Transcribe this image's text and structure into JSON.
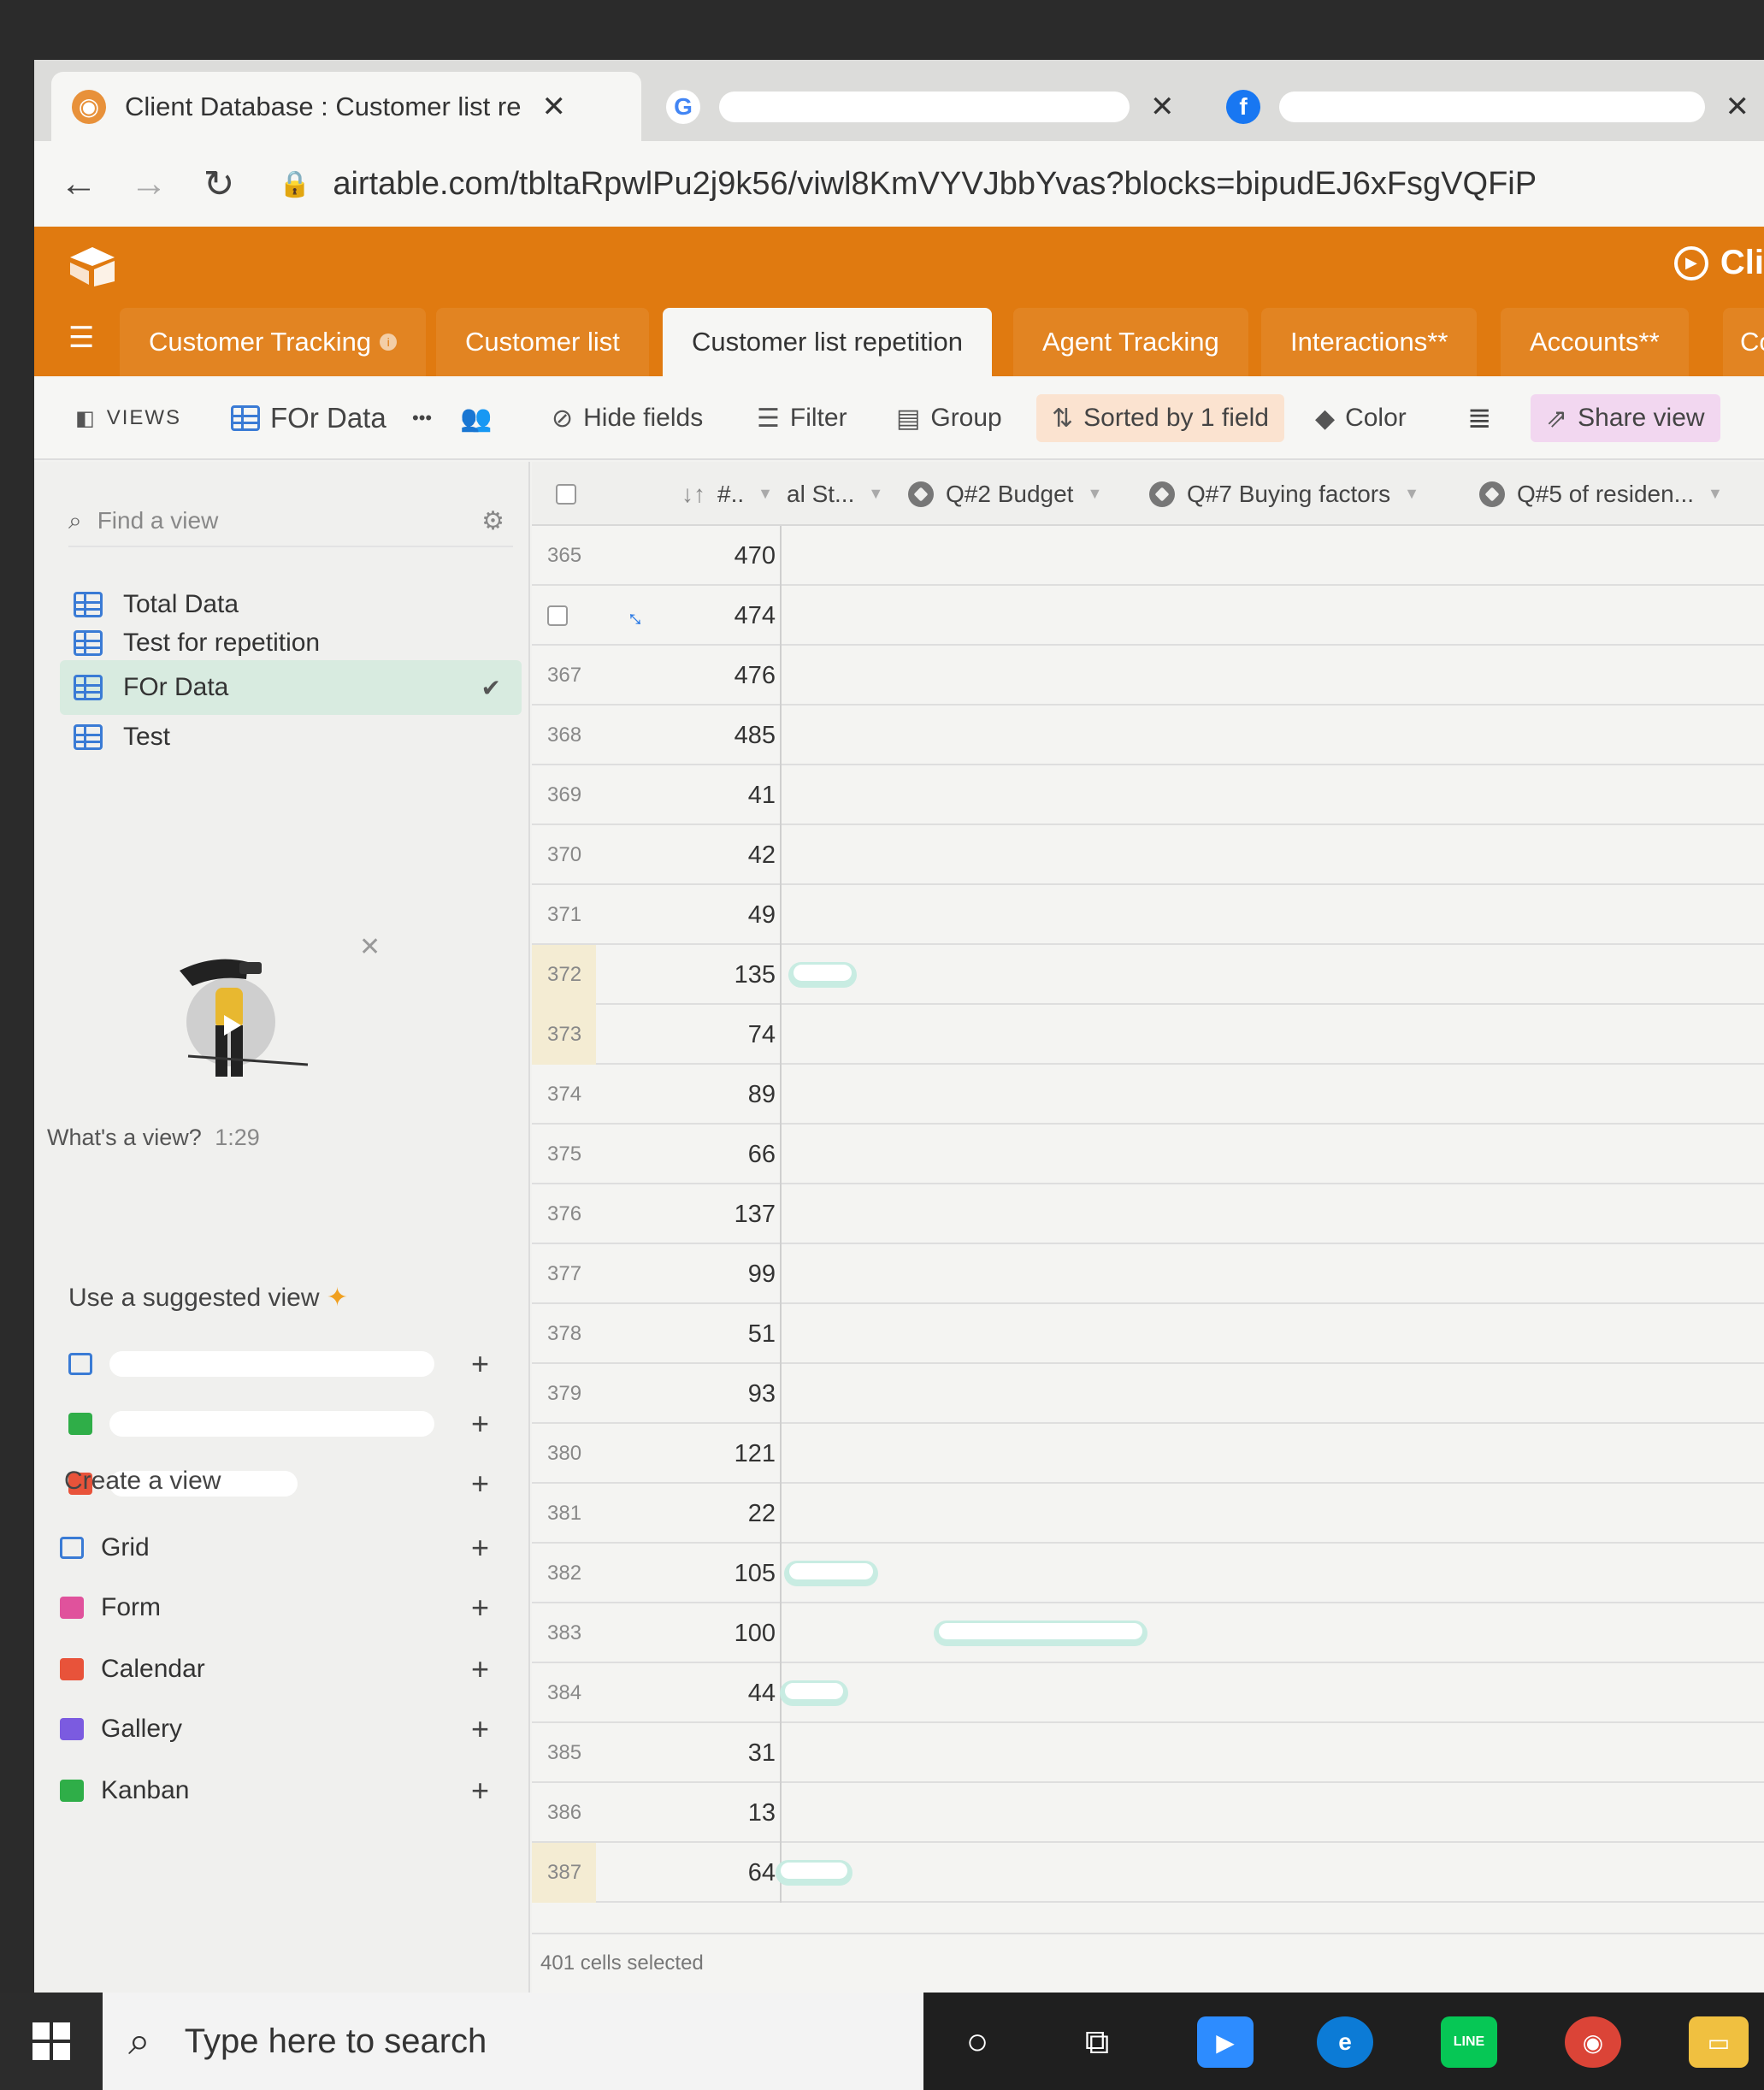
{
  "browser": {
    "tabs": [
      {
        "title": "Client Database : Customer list re",
        "favicon": "airtable-icon",
        "active": true
      },
      {
        "title": "",
        "favicon": "google-icon",
        "active": false
      },
      {
        "title": "",
        "favicon": "facebook-icon",
        "active": false
      }
    ],
    "close_glyph": "✕",
    "url": "airtable.com/tblta​RpwlPu2j9k56/viwl8KmVYVJbbYvas?blocks=bipudEJ6xFsgVQFiP"
  },
  "app": {
    "base_name": "Cli",
    "table_tabs": [
      "Customer Tracking",
      "Customer list",
      "Customer list repetition",
      "Agent Tracking",
      "Interactions**",
      "Accounts**",
      "Co"
    ],
    "active_table": "Customer list repetition",
    "accent_color": "#e07a10"
  },
  "viewbar": {
    "views_label": "VIEWS",
    "current_view": "FOr Data",
    "more": "•••",
    "hide_fields": "Hide fields",
    "filter": "Filter",
    "group": "Group",
    "sorted": "Sorted by 1 field",
    "color": "Color",
    "share": "Share view"
  },
  "sidebar": {
    "find_placeholder": "Find a view",
    "views": [
      "Total Data",
      "Test for repetition",
      "FOr Data",
      "Test"
    ],
    "selected_view": "FOr Data",
    "check": "✔",
    "close": "✕",
    "whats_a_view": "What's a view?",
    "video_time": "1:29",
    "suggested_title": "Use a suggested view",
    "create_title": "Create a view",
    "create_options": [
      {
        "label": "Grid",
        "color": "#3a7bd5"
      },
      {
        "label": "Form",
        "color": "#e0529c"
      },
      {
        "label": "Calendar",
        "color": "#e8533a"
      },
      {
        "label": "Gallery",
        "color": "#7b5be0"
      },
      {
        "label": "Kanban",
        "color": "#2fae48"
      }
    ],
    "plus": "+"
  },
  "grid": {
    "columns": {
      "num": "#..",
      "status": "al St...",
      "q2": "Q#2 Budget",
      "q7": "Q#7 Buying factors",
      "q5": "Q#5 of residen..."
    },
    "sort_glyph": "↓↑",
    "rows": [
      {
        "n": "365",
        "v": "470"
      },
      {
        "n": "",
        "v": "474"
      },
      {
        "n": "367",
        "v": "476"
      },
      {
        "n": "368",
        "v": "485"
      },
      {
        "n": "369",
        "v": "41"
      },
      {
        "n": "370",
        "v": "42"
      },
      {
        "n": "371",
        "v": "49"
      },
      {
        "n": "372",
        "v": "135"
      },
      {
        "n": "373",
        "v": "74"
      },
      {
        "n": "374",
        "v": "89"
      },
      {
        "n": "375",
        "v": "66"
      },
      {
        "n": "376",
        "v": "137"
      },
      {
        "n": "377",
        "v": "99"
      },
      {
        "n": "378",
        "v": "51"
      },
      {
        "n": "379",
        "v": "93"
      },
      {
        "n": "380",
        "v": "121"
      },
      {
        "n": "381",
        "v": "22"
      },
      {
        "n": "382",
        "v": "105"
      },
      {
        "n": "383",
        "v": "100"
      },
      {
        "n": "384",
        "v": "44"
      },
      {
        "n": "385",
        "v": "31"
      },
      {
        "n": "386",
        "v": "13"
      },
      {
        "n": "387",
        "v": "64"
      }
    ],
    "footer": "401 cells selected"
  },
  "taskbar": {
    "search_placeholder": "Type here to search",
    "line_label": "LINE"
  }
}
